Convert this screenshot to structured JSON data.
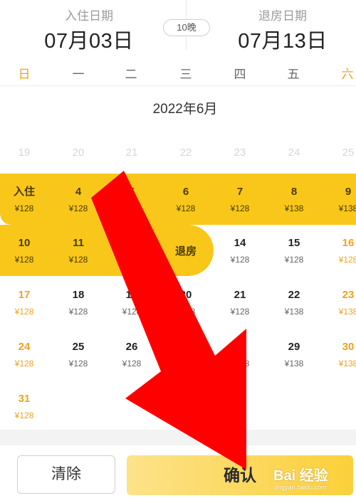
{
  "header": {
    "checkin_label": "入住日期",
    "checkin_date": "07月03日",
    "nights": "10晚",
    "checkout_label": "退房日期",
    "checkout_date": "07月13日"
  },
  "weekdays": [
    "日",
    "一",
    "二",
    "三",
    "四",
    "五",
    "六"
  ],
  "month_title": "2022年6月",
  "calendar_rows": [
    [
      {
        "day": "19",
        "price": ""
      },
      {
        "day": "20",
        "price": ""
      },
      {
        "day": "21",
        "price": ""
      },
      {
        "day": "22",
        "price": ""
      },
      {
        "day": "23",
        "price": ""
      },
      {
        "day": "24",
        "price": ""
      },
      {
        "day": "25",
        "price": ""
      }
    ],
    [
      {
        "day": "入住",
        "price": "¥128"
      },
      {
        "day": "4",
        "price": "¥128"
      },
      {
        "day": "5",
        "price": "¥128"
      },
      {
        "day": "6",
        "price": "¥128"
      },
      {
        "day": "7",
        "price": "¥128"
      },
      {
        "day": "8",
        "price": "¥138"
      },
      {
        "day": "9",
        "price": "¥138"
      }
    ],
    [
      {
        "day": "10",
        "price": "¥128"
      },
      {
        "day": "11",
        "price": "¥128"
      },
      {
        "day": "",
        "price": ""
      },
      {
        "day": "退房",
        "price": ""
      },
      {
        "day": "14",
        "price": "¥128"
      },
      {
        "day": "15",
        "price": "¥128"
      },
      {
        "day": "16",
        "price": "¥128"
      }
    ],
    [
      {
        "day": "17",
        "price": "¥128"
      },
      {
        "day": "18",
        "price": "¥128"
      },
      {
        "day": "19",
        "price": "¥128"
      },
      {
        "day": "20",
        "price": "¥128"
      },
      {
        "day": "21",
        "price": "¥128"
      },
      {
        "day": "22",
        "price": "¥138"
      },
      {
        "day": "23",
        "price": "¥138"
      }
    ],
    [
      {
        "day": "24",
        "price": "¥128"
      },
      {
        "day": "25",
        "price": "¥128"
      },
      {
        "day": "26",
        "price": "¥128"
      },
      {
        "day": "",
        "price": ""
      },
      {
        "day": "28",
        "price": "¥128"
      },
      {
        "day": "29",
        "price": "¥138"
      },
      {
        "day": "30",
        "price": "¥138"
      }
    ],
    [
      {
        "day": "31",
        "price": "¥128"
      }
    ]
  ],
  "footer": {
    "clear_label": "清除",
    "confirm_label": "确认"
  },
  "watermark": {
    "logo": "Bai 经验",
    "url": "jingyan.baidu.com"
  },
  "colors": {
    "accent": "#f8c719",
    "weekend": "#f2a21a",
    "arrow": "#ff0000"
  },
  "icons": [
    "red-arrow-icon"
  ]
}
